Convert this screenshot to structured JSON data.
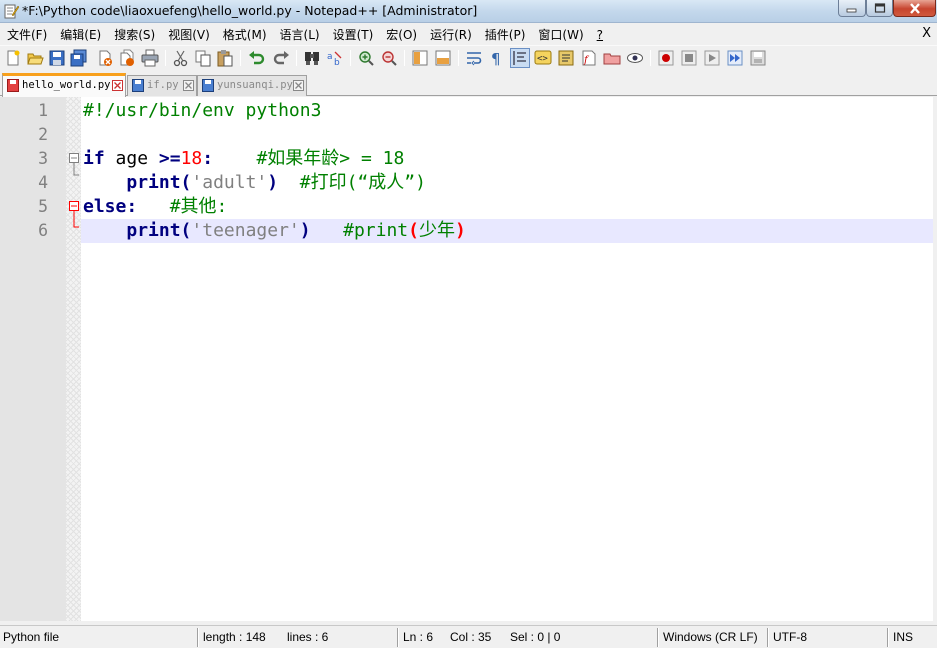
{
  "window": {
    "title": "*F:\\Python code\\liaoxuefeng\\hello_world.py - Notepad++ [Administrator]"
  },
  "menu": {
    "items": [
      {
        "label": "文件(F)"
      },
      {
        "label": "编辑(E)"
      },
      {
        "label": "搜索(S)"
      },
      {
        "label": "视图(V)"
      },
      {
        "label": "格式(M)"
      },
      {
        "label": "语言(L)"
      },
      {
        "label": "设置(T)"
      },
      {
        "label": "宏(O)"
      },
      {
        "label": "运行(R)"
      },
      {
        "label": "插件(P)"
      },
      {
        "label": "窗口(W)"
      },
      {
        "label": "?"
      }
    ],
    "close_label": "X"
  },
  "toolbar": {
    "icons": [
      "new-file-icon",
      "open-file-icon",
      "save-icon",
      "save-all-icon",
      "close-icon",
      "close-all-icon",
      "print-icon",
      "cut-icon",
      "copy-icon",
      "paste-icon",
      "undo-icon",
      "redo-icon",
      "find-icon",
      "replace-icon",
      "zoom-in-icon",
      "zoom-out-icon",
      "sync-vertical-icon",
      "sync-horizontal-icon",
      "word-wrap-icon",
      "show-all-chars-icon",
      "indent-guide-icon",
      "language-icon",
      "function-list-icon",
      "doc-map-icon",
      "folder-as-workspace-icon",
      "monitoring-icon",
      "record-macro-icon",
      "stop-record-icon",
      "play-macro-icon",
      "run-macro-multiple-icon",
      "save-macro-icon"
    ]
  },
  "tabs": [
    {
      "label": "hello_world.py",
      "active": true,
      "modified": true
    },
    {
      "label": "if.py",
      "active": false,
      "modified": false
    },
    {
      "label": "yunsuanqi.py",
      "active": false,
      "modified": false
    }
  ],
  "editor": {
    "line_numbers": [
      "1",
      "2",
      "3",
      "4",
      "5",
      "6"
    ],
    "lines": [
      [
        {
          "t": "#!/usr/bin/env python3",
          "c": "c-comment"
        }
      ],
      [],
      [
        {
          "t": "if",
          "c": "c-kw"
        },
        {
          "t": " age ",
          "c": "c-id"
        },
        {
          "t": ">=",
          "c": "c-op"
        },
        {
          "t": "18",
          "c": "c-num"
        },
        {
          "t": ":",
          "c": "c-op"
        },
        {
          "t": "    ",
          "c": "c-id"
        },
        {
          "t": "#如果年龄> = 18",
          "c": "c-comment"
        }
      ],
      [
        {
          "t": "    ",
          "c": "c-id"
        },
        {
          "t": "print",
          "c": "c-kw"
        },
        {
          "t": "(",
          "c": "c-op"
        },
        {
          "t": "'adult'",
          "c": "c-str"
        },
        {
          "t": ")",
          "c": "c-op"
        },
        {
          "t": "  ",
          "c": "c-id"
        },
        {
          "t": "#打印(“成人”)",
          "c": "c-comment"
        }
      ],
      [
        {
          "t": "else",
          "c": "c-kw"
        },
        {
          "t": ":",
          "c": "c-op"
        },
        {
          "t": "   ",
          "c": "c-id"
        },
        {
          "t": "#其他:",
          "c": "c-comment"
        }
      ],
      [
        {
          "t": "    ",
          "c": "c-id"
        },
        {
          "t": "print",
          "c": "c-kw"
        },
        {
          "t": "(",
          "c": "c-op"
        },
        {
          "t": "'teenager'",
          "c": "c-str"
        },
        {
          "t": ")",
          "c": "c-op"
        },
        {
          "t": "   ",
          "c": "c-id"
        },
        {
          "t": "#print",
          "c": "c-comment"
        },
        {
          "t": "(",
          "c": "c-brace"
        },
        {
          "t": "少年",
          "c": "c-comment"
        },
        {
          "t": ")",
          "c": "c-brace"
        }
      ]
    ]
  },
  "statusbar": {
    "file_type": "Python file",
    "length": "length : 148",
    "lines": "lines : 6",
    "ln": "Ln : 6",
    "col": "Col : 35",
    "sel": "Sel : 0 | 0",
    "eol": "Windows (CR LF)",
    "encoding": "UTF-8",
    "mode": "INS"
  },
  "colors": {
    "keyword": "#00007f",
    "comment": "#008000",
    "number": "#ff0000",
    "string": "#808080",
    "active_tab_accent": "#f8a01c",
    "caret_line": "#e8e8ff"
  }
}
